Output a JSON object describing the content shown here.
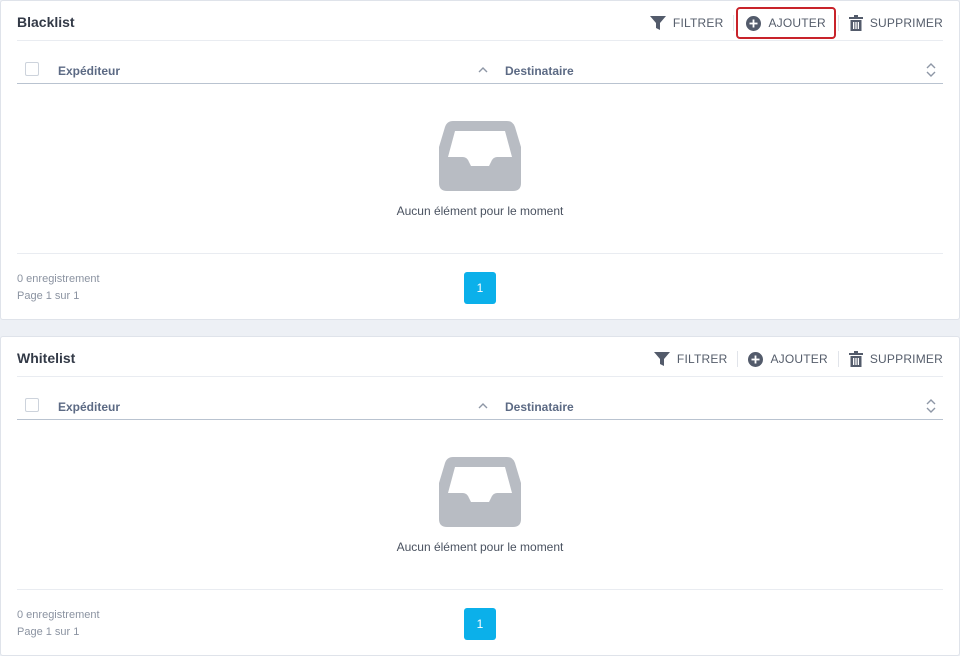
{
  "panels": [
    {
      "title": "Blacklist",
      "toolbar": {
        "filter_label": "FILTRER",
        "add_label": "AJOUTER",
        "delete_label": "SUPPRIMER"
      },
      "columns": {
        "sender": "Expéditeur",
        "recipient": "Destinataire"
      },
      "empty_text": "Aucun élément pour le moment",
      "footer": {
        "records": "0 enregistrement",
        "page_info": "Page 1 sur 1",
        "current_page": "1"
      }
    },
    {
      "title": "Whitelist",
      "toolbar": {
        "filter_label": "FILTRER",
        "add_label": "AJOUTER",
        "delete_label": "SUPPRIMER"
      },
      "columns": {
        "sender": "Expéditeur",
        "recipient": "Destinataire"
      },
      "empty_text": "Aucun élément pour le moment",
      "footer": {
        "records": "0 enregistrement",
        "page_info": "Page 1 sur 1",
        "current_page": "1"
      }
    }
  ],
  "icons": {
    "filter": "filter-icon",
    "add": "plus-circle-icon",
    "delete": "trash-icon",
    "empty": "inbox-tray-icon",
    "sort_up": "chevron-up-icon",
    "sort_both": "sort-icon"
  },
  "colors": {
    "accent": "#0bb0ea",
    "highlight_border": "#c8232a",
    "icon_gray": "#535b6b",
    "empty_icon": "#b8bcc3",
    "background": "#edf0f5"
  }
}
